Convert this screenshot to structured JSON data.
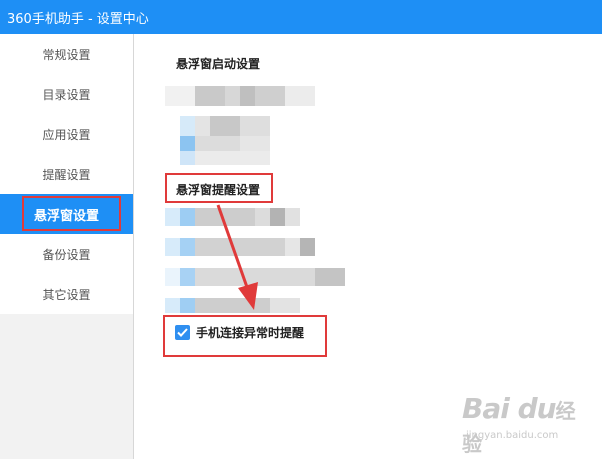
{
  "window": {
    "title": "360手机助手 - 设置中心"
  },
  "sidebar": {
    "items": [
      {
        "label": "常规设置",
        "active": false
      },
      {
        "label": "目录设置",
        "active": false
      },
      {
        "label": "应用设置",
        "active": false
      },
      {
        "label": "提醒设置",
        "active": false
      },
      {
        "label": "悬浮窗设置",
        "active": true
      },
      {
        "label": "备份设置",
        "active": false
      },
      {
        "label": "其它设置",
        "active": false
      }
    ]
  },
  "main": {
    "section1_title": "悬浮窗启动设置",
    "section2_title": "悬浮窗提醒设置",
    "checkbox": {
      "label": "手机连接异常时提醒",
      "checked": true
    }
  },
  "watermark": {
    "brand": "Bai du",
    "brand_suffix": "经验",
    "url": "jingyan.baidu.com"
  },
  "colors": {
    "accent": "#1e8ff5",
    "highlight": "#e03a3a"
  }
}
